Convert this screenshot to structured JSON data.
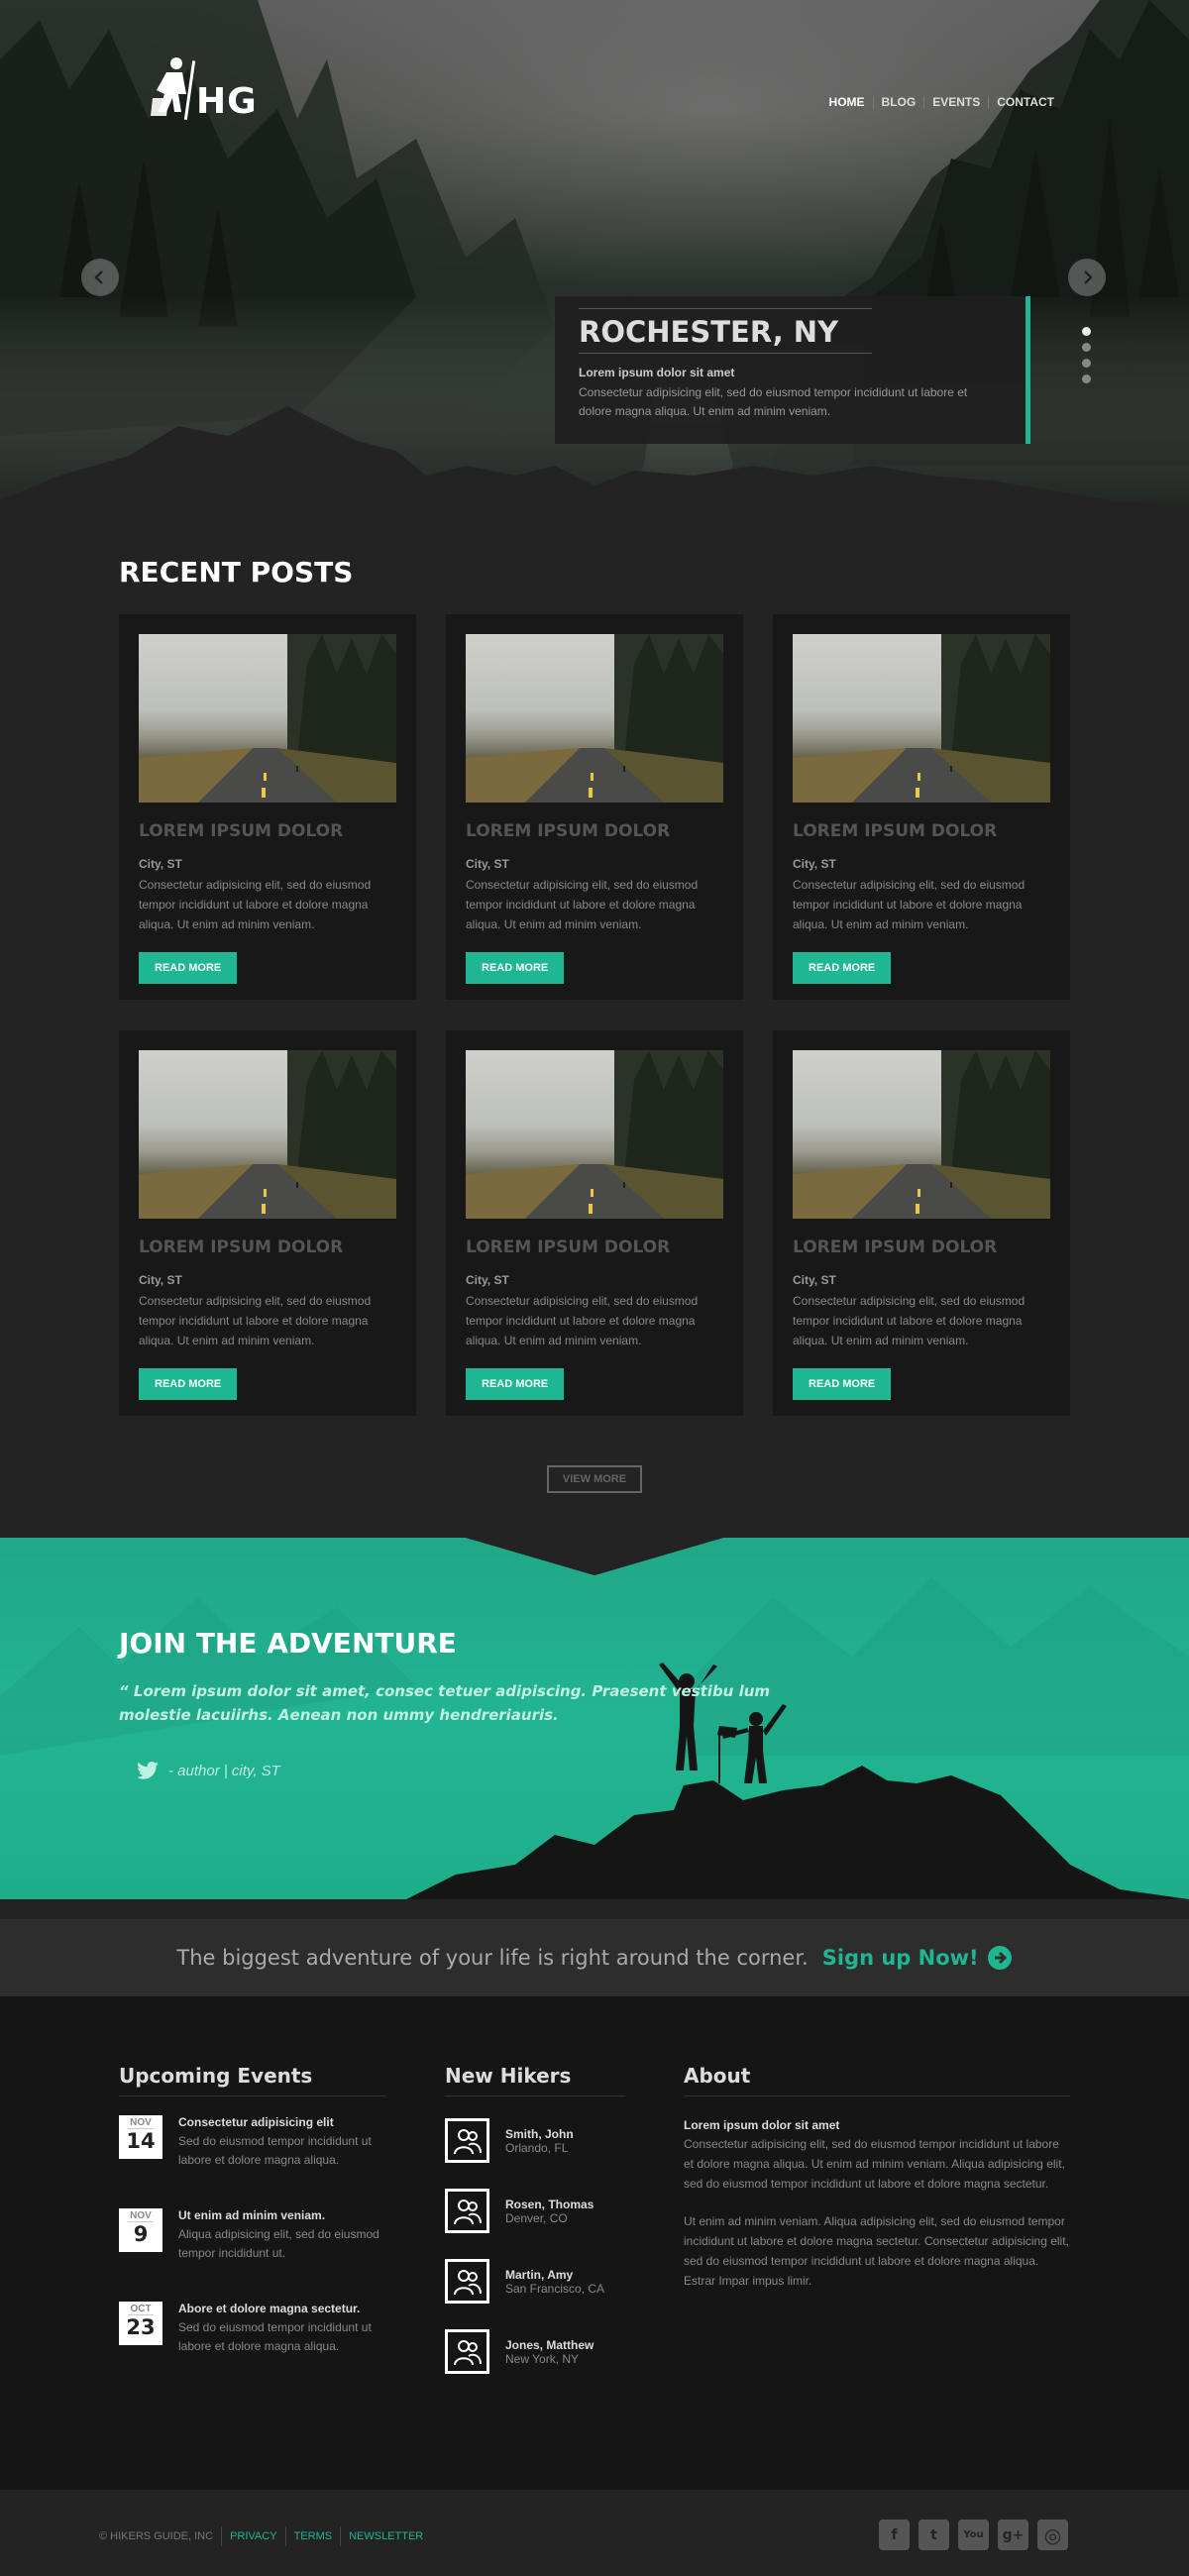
{
  "brand": {
    "logo_text": "HG"
  },
  "nav": {
    "items": [
      "HOME",
      "BLOG",
      "EVENTS",
      "CONTACT"
    ]
  },
  "hero": {
    "title": "ROCHESTER, NY",
    "subtitle": "Lorem ipsum dolor sit amet",
    "text": "Consectetur adipisicing elit, sed do eiusmod tempor incididunt ut labore et dolore magna aliqua. Ut enim ad minim veniam.",
    "slide_count": 4,
    "active_slide": 1
  },
  "recent_posts": {
    "title": "RECENT POSTS",
    "posts": [
      {
        "title": "LOREM IPSUM DOLOR",
        "location": "City, ST",
        "text": "Consectetur adipisicing elit, sed do eiusmod tempor incididunt ut labore et dolore magna aliqua. Ut enim ad minim veniam.",
        "button": "READ MORE"
      },
      {
        "title": "LOREM IPSUM DOLOR",
        "location": "City, ST",
        "text": "Consectetur adipisicing elit, sed do eiusmod tempor incididunt ut labore et dolore magna aliqua. Ut enim ad minim veniam.",
        "button": "READ MORE"
      },
      {
        "title": "LOREM IPSUM DOLOR",
        "location": "City, ST",
        "text": "Consectetur adipisicing elit, sed do eiusmod tempor incididunt ut labore et dolore magna aliqua. Ut enim ad minim veniam.",
        "button": "READ MORE"
      },
      {
        "title": "LOREM IPSUM DOLOR",
        "location": "City, ST",
        "text": "Consectetur adipisicing elit, sed do eiusmod tempor incididunt ut labore et dolore magna aliqua. Ut enim ad minim veniam.",
        "button": "READ MORE"
      },
      {
        "title": "LOREM IPSUM DOLOR",
        "location": "City, ST",
        "text": "Consectetur adipisicing elit, sed do eiusmod tempor incididunt ut labore et dolore magna aliqua. Ut enim ad minim veniam.",
        "button": "READ MORE"
      },
      {
        "title": "LOREM IPSUM DOLOR",
        "location": "City, ST",
        "text": "Consectetur adipisicing elit, sed do eiusmod tempor incididunt ut labore et dolore magna aliqua. Ut enim ad minim veniam.",
        "button": "READ MORE"
      }
    ],
    "view_more": "VIEW MORE"
  },
  "join": {
    "title": "JOIN THE ADVENTURE",
    "quote": "“ Lorem ipsum dolor sit amet, consec tetuer adipiscing. Praesent vestibu lum molestie lacuiirhs. Aenean non ummy hendreriauris.",
    "author": "- author | city, ST"
  },
  "cta": {
    "text": "The biggest adventure of your life is right around the corner.",
    "link": "Sign up Now!"
  },
  "footer": {
    "events": {
      "title": "Upcoming Events",
      "items": [
        {
          "month": "NOV",
          "day": "14",
          "title": "Consectetur adipisicing elit",
          "text": "Sed do eiusmod tempor incididunt ut labore et dolore magna aliqua."
        },
        {
          "month": "NOV",
          "day": "9",
          "title": "Ut enim ad minim veniam.",
          "text": "Aliqua adipisicing elit, sed do eiusmod tempor incididunt ut."
        },
        {
          "month": "OCT",
          "day": "23",
          "title": "Abore et dolore magna sectetur.",
          "text": "Sed do eiusmod tempor incididunt ut labore et dolore magna aliqua."
        }
      ]
    },
    "hikers": {
      "title": "New Hikers",
      "items": [
        {
          "name": "Smith, John",
          "location": "Orlando, FL"
        },
        {
          "name": "Rosen, Thomas",
          "location": "Denver, CO"
        },
        {
          "name": "Martin, Amy",
          "location": "San Francisco, CA"
        },
        {
          "name": "Jones, Matthew",
          "location": "New York, NY"
        }
      ]
    },
    "about": {
      "title": "About",
      "subtitle": "Lorem ipsum dolor sit amet",
      "p1": "Consectetur adipisicing elit, sed do eiusmod tempor incididunt ut labore et dolore magna aliqua. Ut enim ad minim veniam. Aliqua adipisicing elit, sed do eiusmod tempor incididunt ut labore et dolore magna sectetur.",
      "p2": "Ut enim ad minim veniam. Aliqua adipisicing elit, sed do eiusmod tempor incididunt ut labore et dolore magna sectetur. Consectetur adipisicing elit, sed do eiusmod tempor incididunt ut labore et dolore magna aliqua. Estrar Impar impus limir."
    }
  },
  "bottom": {
    "copyright": "© HIKERS GUIDE, INC",
    "links": [
      "PRIVACY",
      "TERMS",
      "NEWSLETTER"
    ],
    "social": [
      {
        "icon": "facebook-icon",
        "glyph": "f"
      },
      {
        "icon": "twitter-icon",
        "glyph": "t"
      },
      {
        "icon": "youtube-icon",
        "glyph": "You"
      },
      {
        "icon": "google-plus-icon",
        "glyph": "g+"
      },
      {
        "icon": "instagram-icon",
        "glyph": "◎"
      }
    ]
  },
  "colors": {
    "accent": "#1fb694",
    "background": "#232323",
    "card": "#181818",
    "footer": "#151515"
  }
}
